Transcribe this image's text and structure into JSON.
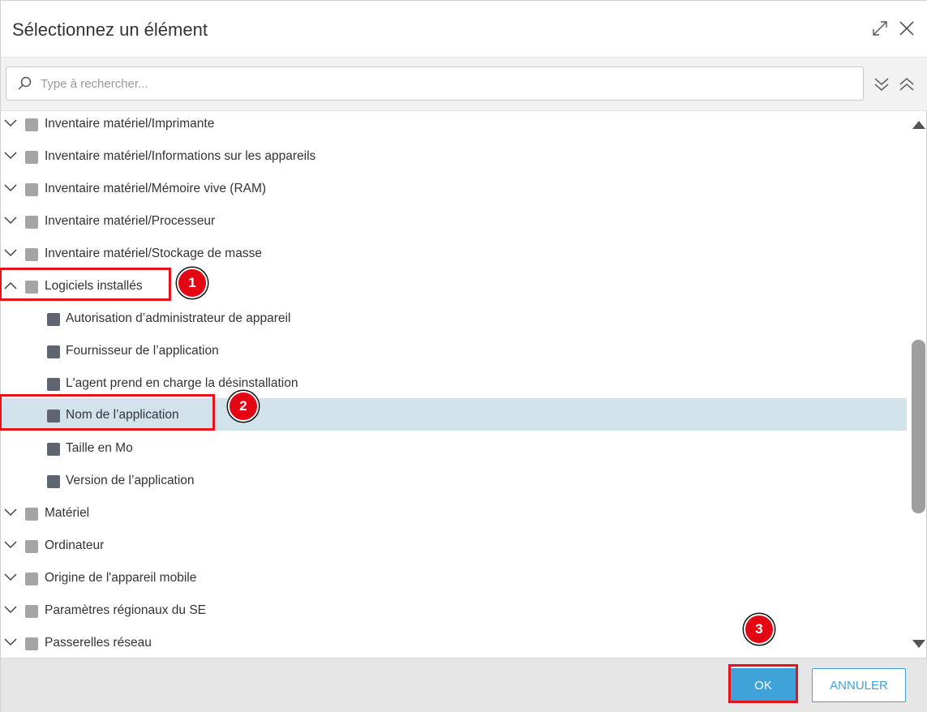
{
  "dialog": {
    "title": "Sélectionnez un élément",
    "expand_icon": "expand-diagonal-icon",
    "close_icon": "close-icon"
  },
  "search": {
    "placeholder": "Type à rechercher...",
    "value": "",
    "icon": "search-icon",
    "expand_all_icon": "double-chevron-down-icon",
    "collapse_all_icon": "double-chevron-up-icon"
  },
  "tree": {
    "items": [
      {
        "label": "Inventaire matériel/Imprimante",
        "level": 0,
        "expanded": false
      },
      {
        "label": "Inventaire matériel/Informations sur les appareils",
        "level": 0,
        "expanded": false
      },
      {
        "label": "Inventaire matériel/Mémoire vive (RAM)",
        "level": 0,
        "expanded": false
      },
      {
        "label": "Inventaire matériel/Processeur",
        "level": 0,
        "expanded": false
      },
      {
        "label": "Inventaire matériel/Stockage de masse",
        "level": 0,
        "expanded": false
      },
      {
        "label": "Logiciels installés",
        "level": 0,
        "expanded": true
      },
      {
        "label": "Autorisation d’administrateur de appareil",
        "level": 1
      },
      {
        "label": "Fournisseur de l’application",
        "level": 1
      },
      {
        "label": "L'agent prend en charge la désinstallation",
        "level": 1
      },
      {
        "label": "Nom de l’application",
        "level": 1,
        "selected": true
      },
      {
        "label": "Taille en Mo",
        "level": 1
      },
      {
        "label": "Version de l’application",
        "level": 1
      },
      {
        "label": "Matériel",
        "level": 0,
        "expanded": false
      },
      {
        "label": "Ordinateur",
        "level": 0,
        "expanded": false
      },
      {
        "label": "Origine de l'appareil mobile",
        "level": 0,
        "expanded": false
      },
      {
        "label": "Paramètres régionaux du SE",
        "level": 0,
        "expanded": false
      },
      {
        "label": "Passerelles réseau",
        "level": 0,
        "expanded": false
      }
    ]
  },
  "footer": {
    "ok_label": "OK",
    "cancel_label": "ANNULER"
  },
  "annotations": {
    "step1": "1",
    "step2": "2",
    "step3": "3"
  },
  "colors": {
    "accent": "#3fa3d9",
    "selected_row": "#d3e3ec",
    "highlight": "#e8141c"
  }
}
